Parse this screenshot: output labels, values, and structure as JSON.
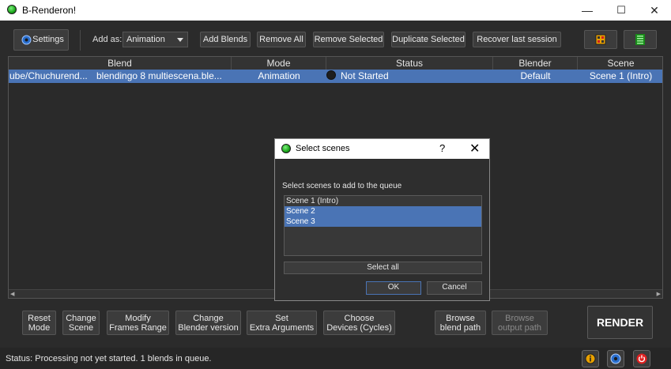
{
  "window": {
    "title": "B-Renderon!",
    "minimize": "—",
    "maximize": "☐",
    "close": "✕"
  },
  "toolbar": {
    "settings": "Settings",
    "add_as_label": "Add as:",
    "add_as_value": "Animation",
    "add_blends": "Add Blends",
    "remove_all": "Remove All",
    "remove_selected": "Remove Selected",
    "duplicate_selected": "Duplicate Selected",
    "recover_last_session": "Recover last session"
  },
  "table": {
    "columns": [
      "Blend",
      "Mode",
      "Status",
      "Blender",
      "Scene"
    ],
    "rows": [
      {
        "path": "ube/Chuchurend...",
        "blend": "blendingo 8 multiescena.ble...",
        "mode": "Animation",
        "status": "Not Started",
        "blender": "Default",
        "scene": "Scene 1 (Intro)"
      }
    ]
  },
  "bottom_buttons": {
    "reset_mode": [
      "Reset",
      "Mode"
    ],
    "change_scene": [
      "Change",
      "Scene"
    ],
    "modify_frames": [
      "Modify",
      "Frames Range"
    ],
    "change_blender": [
      "Change",
      "Blender version"
    ],
    "set_args": [
      "Set",
      "Extra Arguments"
    ],
    "choose_devices": [
      "Choose",
      "Devices (Cycles)"
    ],
    "browse_blend": [
      "Browse",
      "blend path"
    ],
    "browse_output": [
      "Browse",
      "output path"
    ],
    "render": "RENDER"
  },
  "status_bar": {
    "text": "Status: Processing not yet started. 1 blends in queue."
  },
  "dialog": {
    "title": "Select scenes",
    "help": "?",
    "close": "✕",
    "prompt": "Select scenes to add to the queue",
    "scenes": [
      {
        "label": "Scene 1 (Intro)",
        "selected": false
      },
      {
        "label": "Scene 2",
        "selected": true
      },
      {
        "label": "Scene 3",
        "selected": true
      }
    ],
    "select_all": "Select all",
    "ok": "OK",
    "cancel": "Cancel"
  },
  "colors": {
    "selection": "#4a74b5",
    "background": "#2b2b2b",
    "accent_green": "#1aa51a",
    "icon_orange": "#e8a000",
    "icon_red": "#e02020"
  },
  "icons": {
    "settings": "gear-icon",
    "toolbar_right_1": "spreadsheet-icon",
    "toolbar_right_2": "list-icon",
    "info": "info-icon",
    "blender": "blender-logo-icon",
    "power": "power-icon"
  }
}
